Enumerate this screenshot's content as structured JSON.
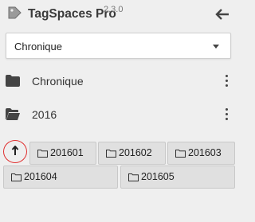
{
  "header": {
    "app_name": "TagSpaces Pro",
    "version": "2.3.0",
    "back_icon": "arrow-left-icon",
    "logo_icon": "tag-logo-icon"
  },
  "location_select": {
    "selected": "Chronique"
  },
  "tree": [
    {
      "label": "Chronique",
      "icon": "folder-icon"
    },
    {
      "label": "2016",
      "icon": "folder-open-icon"
    }
  ],
  "subfolders": {
    "up_icon": "arrow-up-icon",
    "items": [
      "201601",
      "201602",
      "201603",
      "201604",
      "201605"
    ]
  },
  "colors": {
    "background": "#efefef",
    "highlight_ring": "#e03030",
    "chip": "#e0e0e0"
  }
}
